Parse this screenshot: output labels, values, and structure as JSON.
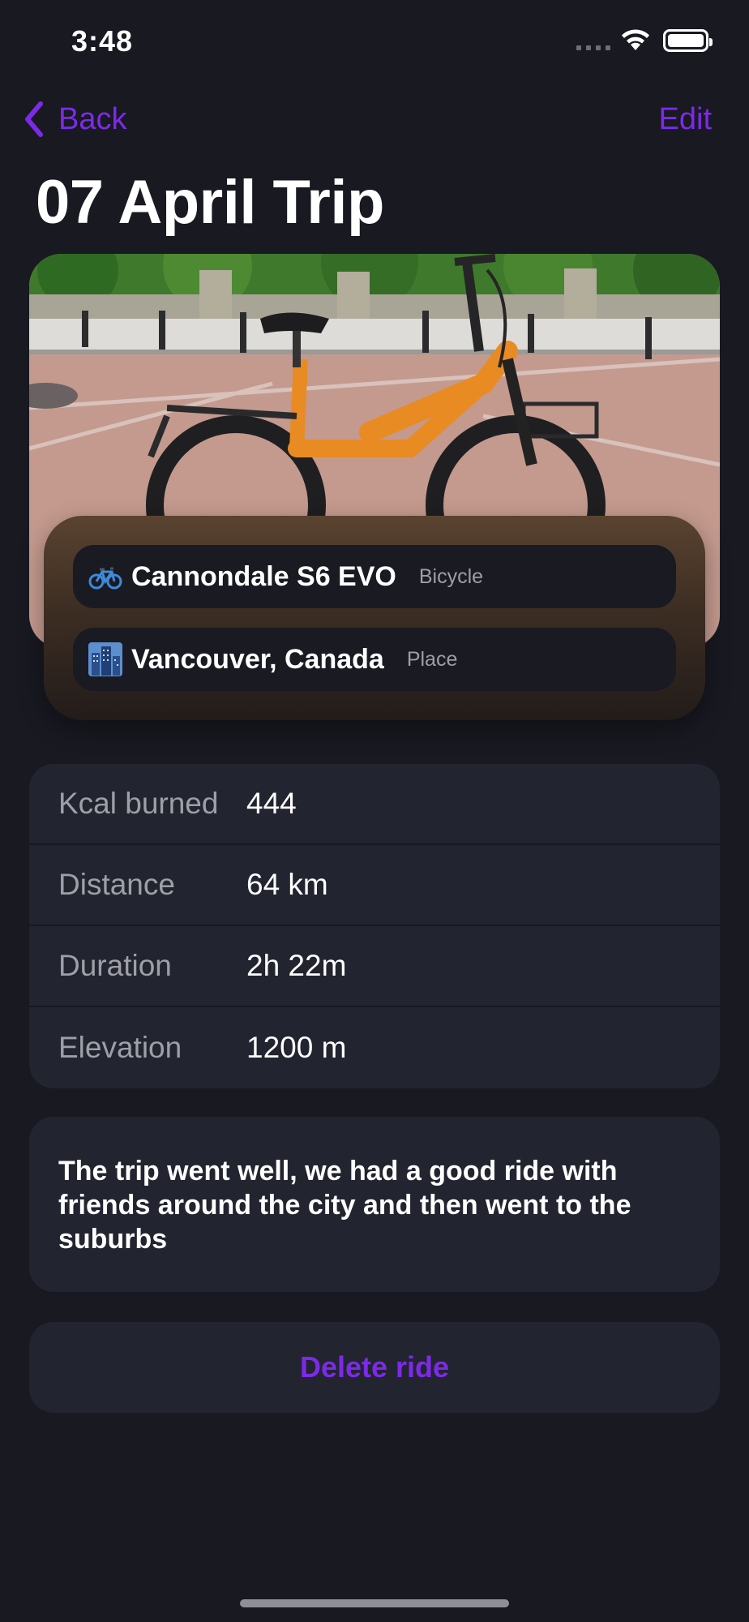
{
  "status_bar": {
    "time": "3:48"
  },
  "nav": {
    "back_label": "Back",
    "edit_label": "Edit"
  },
  "title": "07 April Trip",
  "tags": [
    {
      "icon": "bicycle-emoji-icon",
      "name": "Cannondale S6 EVO",
      "kind": "Bicycle"
    },
    {
      "icon": "cityscape-emoji-icon",
      "name": "Vancouver, Canada",
      "kind": "Place"
    }
  ],
  "stats": [
    {
      "label": "Kcal burned",
      "value": "444"
    },
    {
      "label": "Distance",
      "value": "64 km"
    },
    {
      "label": "Duration",
      "value": "2h 22m"
    },
    {
      "label": "Elevation",
      "value": "1200 m"
    }
  ],
  "notes": "The trip went well, we had a good ride with friends around the city and then went to the suburbs",
  "delete_label": "Delete ride",
  "colors": {
    "accent": "#7d2ae8",
    "background": "#181921",
    "card": "#22242f"
  }
}
